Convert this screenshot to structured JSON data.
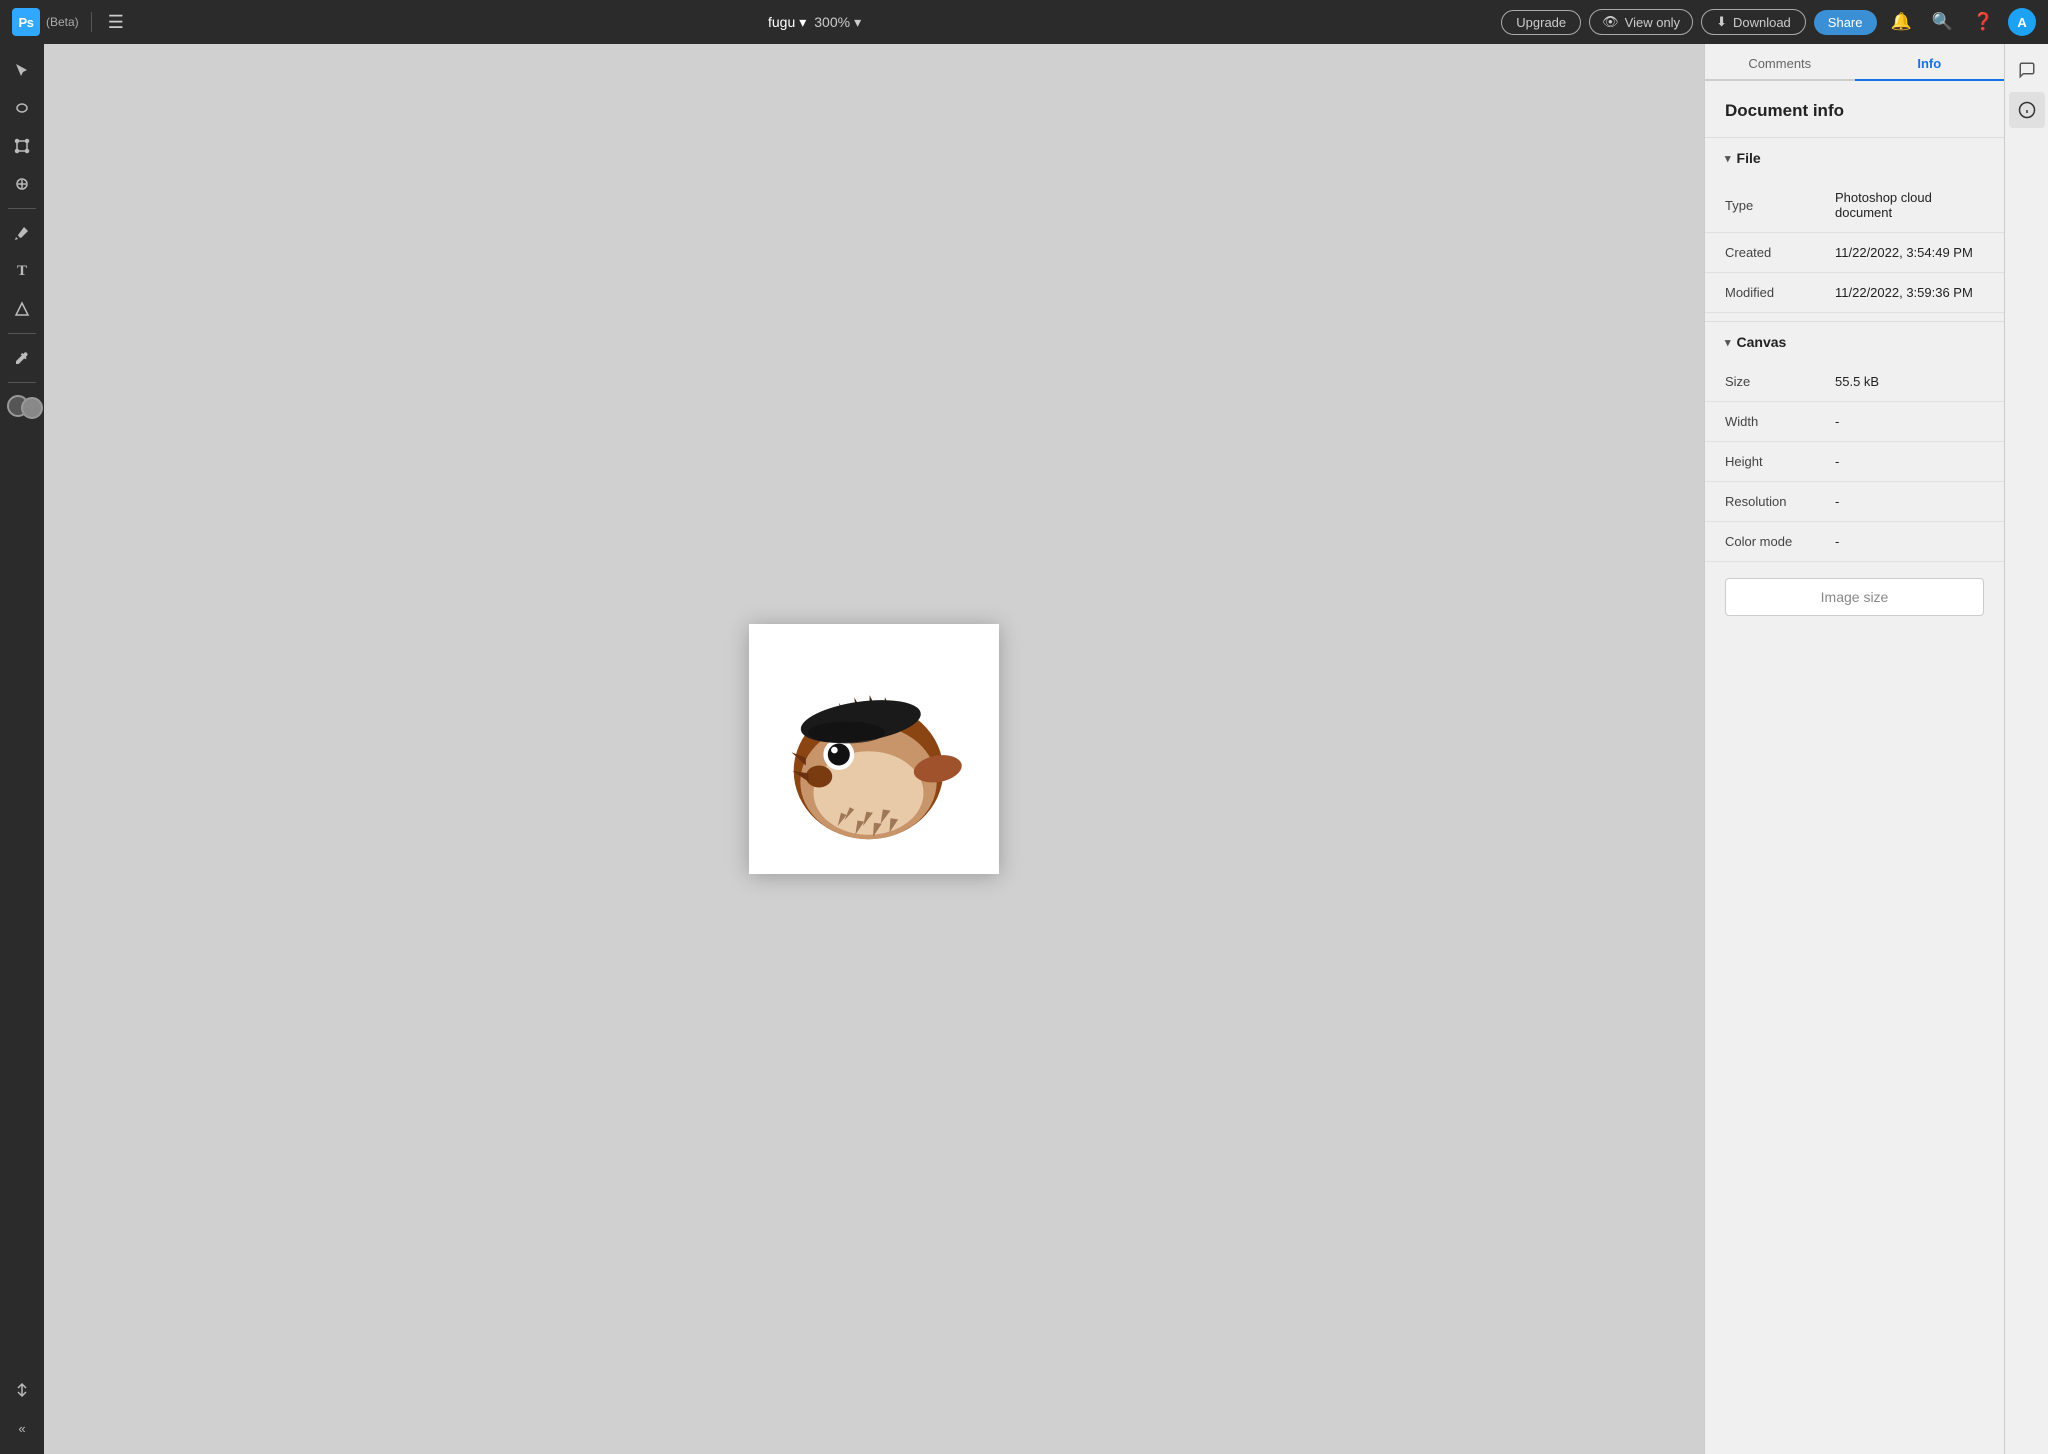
{
  "app": {
    "logo": "Ps",
    "beta_label": "(Beta)",
    "filename": "fugu",
    "zoom": "300%",
    "upgrade_label": "Upgrade",
    "view_only_label": "View only",
    "download_label": "Download",
    "share_label": "Share"
  },
  "toolbar": {
    "tools": [
      {
        "name": "select-tool",
        "icon": "↖",
        "label": "Select"
      },
      {
        "name": "crop-tool",
        "icon": "◎",
        "label": "Lasso"
      },
      {
        "name": "transform-tool",
        "icon": "⤢",
        "label": "Transform"
      },
      {
        "name": "heal-tool",
        "icon": "✦",
        "label": "Heal"
      },
      {
        "name": "brush-tool",
        "icon": "✏",
        "label": "Brush"
      },
      {
        "name": "text-tool",
        "icon": "T",
        "label": "Type"
      },
      {
        "name": "shape-tool",
        "icon": "⬡",
        "label": "Shape"
      },
      {
        "name": "eyedropper-tool",
        "icon": "⊕",
        "label": "Eyedropper"
      }
    ],
    "collapse_label": "«"
  },
  "right_panel": {
    "tabs": [
      {
        "label": "Comments",
        "active": false
      },
      {
        "label": "Info",
        "active": true
      }
    ],
    "doc_info": {
      "title": "Document info",
      "sections": {
        "file": {
          "label": "File",
          "rows": [
            {
              "label": "Type",
              "value": "Photoshop cloud document"
            },
            {
              "label": "Created",
              "value": "11/22/2022, 3:54:49 PM"
            },
            {
              "label": "Modified",
              "value": "11/22/2022, 3:59:36 PM"
            }
          ]
        },
        "canvas": {
          "label": "Canvas",
          "rows": [
            {
              "label": "Size",
              "value": "55.5 kB"
            },
            {
              "label": "Width",
              "value": "-"
            },
            {
              "label": "Height",
              "value": "-"
            },
            {
              "label": "Resolution",
              "value": "-"
            },
            {
              "label": "Color mode",
              "value": "-"
            }
          ]
        }
      },
      "image_size_button": "Image size"
    }
  },
  "far_right": {
    "icons": [
      {
        "name": "comment-icon",
        "icon": "💬"
      },
      {
        "name": "info-icon",
        "icon": "ℹ"
      }
    ]
  }
}
